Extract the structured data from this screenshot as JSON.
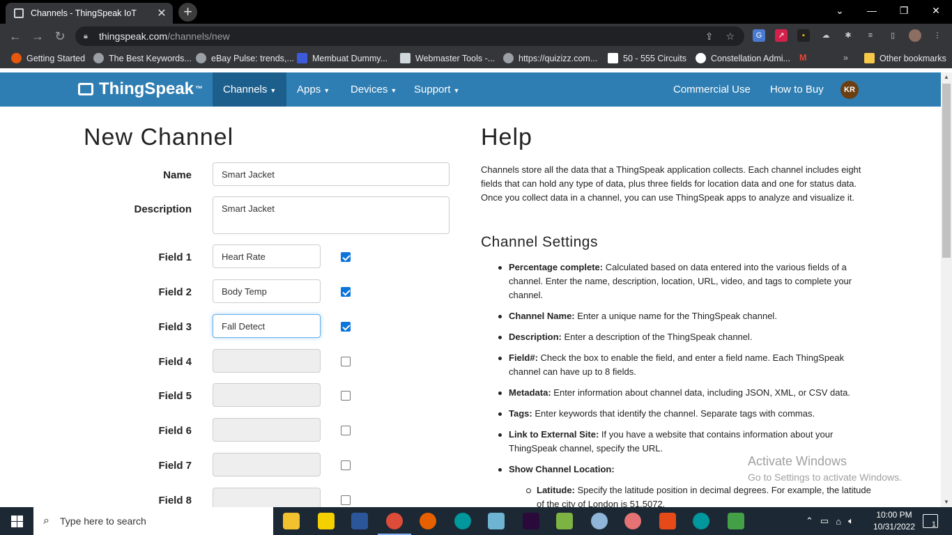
{
  "browser": {
    "tab_title": "Channels - ThingSpeak IoT",
    "tab_close": "✕",
    "new_tab": "+",
    "url_host": "thingspeak.com",
    "url_path": "/channels/new",
    "bookmarks": [
      {
        "label": "Getting Started",
        "color": "#e8580c"
      },
      {
        "label": "The Best Keywords...",
        "color": "#9aa0a6"
      },
      {
        "label": "eBay Pulse: trends,...",
        "color": "#9aa0a6"
      },
      {
        "label": "Membuat Dummy...",
        "color": "#3b5bdb"
      },
      {
        "label": "Webmaster Tools -...",
        "color": "#cfd8dc"
      },
      {
        "label": "https://quizizz.com...",
        "color": "#9aa0a6"
      },
      {
        "label": "50 - 555 Circuits",
        "color": "#ffffff"
      },
      {
        "label": "Constellation Admi...",
        "color": "#ffffff"
      }
    ],
    "bookmarks_more": "»",
    "other_bookmarks": "Other bookmarks"
  },
  "nav": {
    "logo": "ThingSpeak",
    "logo_tm": "™",
    "items": [
      "Channels",
      "Apps",
      "Devices",
      "Support"
    ],
    "right_items": [
      "Commercial Use",
      "How to Buy"
    ],
    "avatar_initials": "KR"
  },
  "form": {
    "title": "New Channel",
    "name_label": "Name",
    "name_value": "Smart Jacket",
    "description_label": "Description",
    "description_value": "Smart Jacket",
    "fields": [
      {
        "label": "Field 1",
        "value": "Heart Rate",
        "checked": true
      },
      {
        "label": "Field 2",
        "value": "Body Temp",
        "checked": true
      },
      {
        "label": "Field 3",
        "value": "Fall Detect",
        "checked": true
      },
      {
        "label": "Field 4",
        "value": "",
        "checked": false
      },
      {
        "label": "Field 5",
        "value": "",
        "checked": false
      },
      {
        "label": "Field 6",
        "value": "",
        "checked": false
      },
      {
        "label": "Field 7",
        "value": "",
        "checked": false
      },
      {
        "label": "Field 8",
        "value": "",
        "checked": false
      }
    ]
  },
  "help": {
    "title": "Help",
    "intro": "Channels store all the data that a ThingSpeak application collects. Each channel includes eight fields that can hold any type of data, plus three fields for location data and one for status data. Once you collect data in a channel, you can use ThingSpeak apps to analyze and visualize it.",
    "section_title": "Channel Settings",
    "items": [
      {
        "term": "Percentage complete:",
        "text": " Calculated based on data entered into the various fields of a channel. Enter the name, description, location, URL, video, and tags to complete your channel."
      },
      {
        "term": "Channel Name:",
        "text": " Enter a unique name for the ThingSpeak channel."
      },
      {
        "term": "Description:",
        "text": " Enter a description of the ThingSpeak channel."
      },
      {
        "term": "Field#:",
        "text": " Check the box to enable the field, and enter a field name. Each ThingSpeak channel can have up to 8 fields."
      },
      {
        "term": "Metadata:",
        "text": " Enter information about channel data, including JSON, XML, or CSV data."
      },
      {
        "term": "Tags:",
        "text": " Enter keywords that identify the channel. Separate tags with commas."
      },
      {
        "term": "Link to External Site:",
        "text": " If you have a website that contains information about your ThingSpeak channel, specify the URL."
      },
      {
        "term": "Show Channel Location:",
        "text": ""
      }
    ],
    "sub_item": {
      "term": "Latitude:",
      "text": " Specify the latitude position in decimal degrees. For example, the latitude of the city of London is 51.5072."
    }
  },
  "watermark": {
    "line1": "Activate Windows",
    "line2": "Go to Settings to activate Windows."
  },
  "taskbar": {
    "search_placeholder": "Type here to search",
    "time": "10:00 PM",
    "date": "10/31/2022",
    "notifications": "1"
  }
}
